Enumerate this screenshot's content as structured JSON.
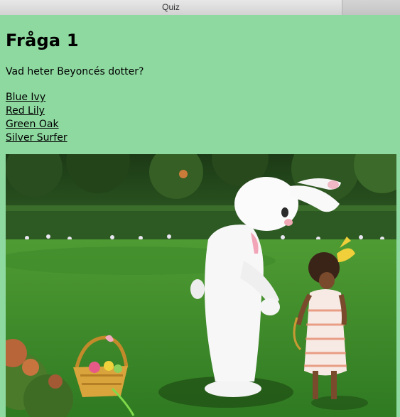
{
  "window": {
    "title": "Quiz"
  },
  "quiz": {
    "heading": "Fråga 1",
    "question": "Vad heter Beyoncés dotter?",
    "answers": [
      {
        "label": "Blue Ivy"
      },
      {
        "label": "Red Lily"
      },
      {
        "label": "Green Oak"
      },
      {
        "label": "Silver Surfer"
      }
    ]
  },
  "colors": {
    "page_background": "#8ed9a0"
  }
}
